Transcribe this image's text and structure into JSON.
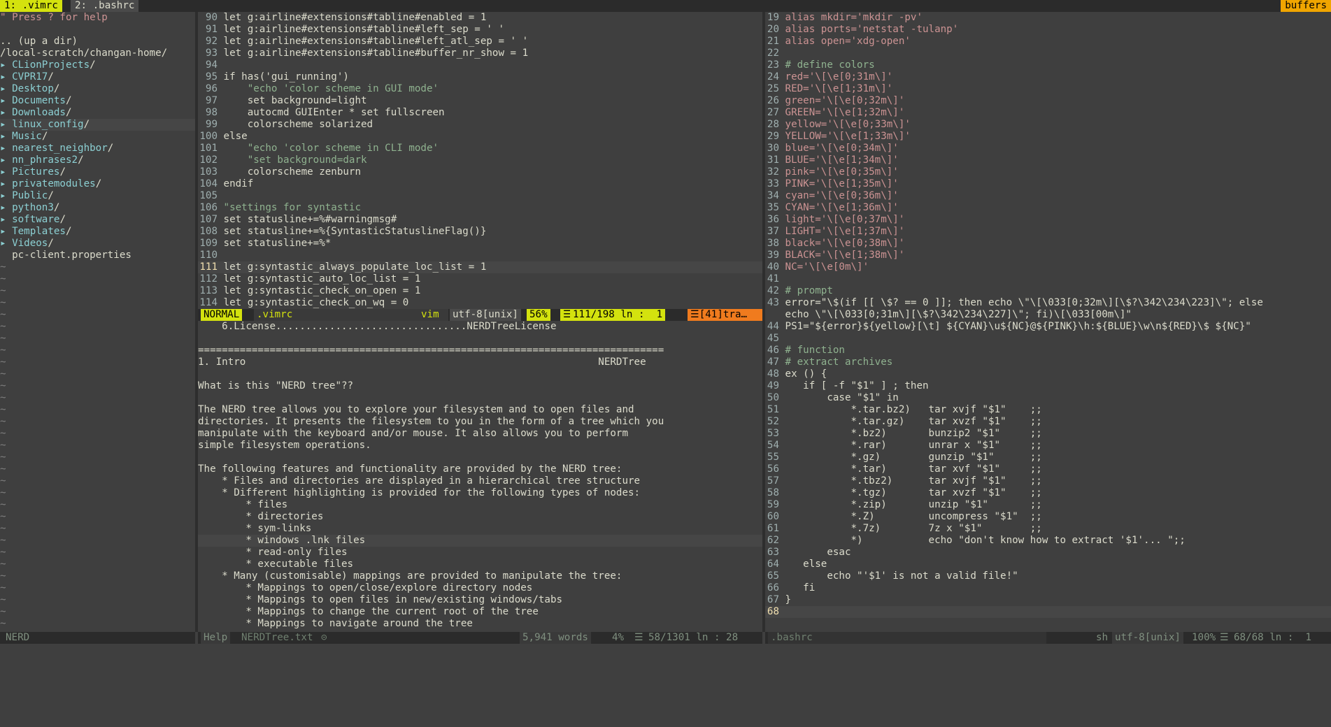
{
  "tabline": {
    "tabs": [
      {
        "label": "1: .vimrc",
        "active": true
      },
      {
        "label": "2: .bashrc",
        "active": false
      }
    ],
    "buffers_label": "buffers"
  },
  "nerdtree": {
    "lines": [
      {
        "text": "\" Press ? for help",
        "kind": "cmt"
      },
      {
        "text": "",
        "kind": "plain"
      },
      {
        "text": ".. (up a dir)",
        "kind": "plain"
      },
      {
        "text": "/local-scratch/changan-home/",
        "kind": "plain"
      },
      {
        "text": "CLionProjects",
        "kind": "dir"
      },
      {
        "text": "CVPR17",
        "kind": "dir"
      },
      {
        "text": "Desktop",
        "kind": "dir"
      },
      {
        "text": "Documents",
        "kind": "dir"
      },
      {
        "text": "Downloads",
        "kind": "dir"
      },
      {
        "text": "linux_config",
        "kind": "dir",
        "current": true
      },
      {
        "text": "Music",
        "kind": "dir"
      },
      {
        "text": "nearest_neighbor",
        "kind": "dir"
      },
      {
        "text": "nn_phrases2",
        "kind": "dir"
      },
      {
        "text": "Pictures",
        "kind": "dir"
      },
      {
        "text": "privatemodules",
        "kind": "dir"
      },
      {
        "text": "Public",
        "kind": "dir"
      },
      {
        "text": "python3",
        "kind": "dir"
      },
      {
        "text": "software",
        "kind": "dir"
      },
      {
        "text": "Templates",
        "kind": "dir"
      },
      {
        "text": "Videos",
        "kind": "dir"
      },
      {
        "text": "  pc-client.properties",
        "kind": "plain"
      }
    ],
    "status": "NERD"
  },
  "vimrc": {
    "lines": [
      {
        "n": "90",
        "t": "let g:airline#extensions#tabline#enabled = 1"
      },
      {
        "n": "91",
        "t": "let g:airline#extensions#tabline#left_sep = ' '"
      },
      {
        "n": "92",
        "t": "let g:airline#extensions#tabline#left_atl_sep = ' '"
      },
      {
        "n": "93",
        "t": "let g:airline#extensions#tabline#buffer_nr_show = 1"
      },
      {
        "n": "94",
        "t": ""
      },
      {
        "n": "95",
        "t": "if has('gui_running')"
      },
      {
        "n": "96",
        "t": "    \"echo 'color scheme in GUI mode'"
      },
      {
        "n": "97",
        "t": "    set background=light"
      },
      {
        "n": "98",
        "t": "    autocmd GUIEnter * set fullscreen"
      },
      {
        "n": "99",
        "t": "    colorscheme solarized"
      },
      {
        "n": "100",
        "t": "else"
      },
      {
        "n": "101",
        "t": "    \"echo 'color scheme in CLI mode'"
      },
      {
        "n": "102",
        "t": "    \"set background=dark"
      },
      {
        "n": "103",
        "t": "    colorscheme zenburn"
      },
      {
        "n": "104",
        "t": "endif"
      },
      {
        "n": "105",
        "t": ""
      },
      {
        "n": "106",
        "t": "\"settings for syntastic"
      },
      {
        "n": "107",
        "t": "set statusline+=%#warningmsg#"
      },
      {
        "n": "108",
        "t": "set statusline+=%{SyntasticStatuslineFlag()}"
      },
      {
        "n": "109",
        "t": "set statusline+=%*"
      },
      {
        "n": "110",
        "t": ""
      },
      {
        "n": "111",
        "t": "let g:syntastic_always_populate_loc_list = 1",
        "current": true
      },
      {
        "n": "112",
        "t": "let g:syntastic_auto_loc_list = 1"
      },
      {
        "n": "113",
        "t": "let g:syntastic_check_on_open = 1"
      },
      {
        "n": "114",
        "t": "let g:syntastic_check_on_wq = 0"
      }
    ],
    "status": {
      "mode": "NORMAL",
      "file": ".vimrc",
      "filetype": "vim",
      "encoding": "utf-8[unix]",
      "percent": "56%",
      "position": "111/198 ln :  1",
      "warning": "☰[41]tra…"
    }
  },
  "help": {
    "lines": [
      "    6.License................................NERDTreeLicense",
      "",
      "==============================================================================",
      "1. Intro                                                           NERDTree",
      "",
      "What is this \"NERD tree\"??",
      "",
      "The NERD tree allows you to explore your filesystem and to open files and",
      "directories. It presents the filesystem to you in the form of a tree which you",
      "manipulate with the keyboard and/or mouse. It also allows you to perform",
      "simple filesystem operations.",
      "",
      "The following features and functionality are provided by the NERD tree:",
      "    * Files and directories are displayed in a hierarchical tree structure",
      "    * Different highlighting is provided for the following types of nodes:",
      "        * files",
      "        * directories",
      "        * sym-links",
      "        * windows .lnk files",
      "        * read-only files",
      "        * executable files",
      "    * Many (customisable) mappings are provided to manipulate the tree:",
      "        * Mappings to open/close/explore directory nodes",
      "        * Mappings to open files in new/existing windows/tabs",
      "        * Mappings to change the current root of the tree",
      "        * Mappings to navigate around the tree"
    ],
    "status": {
      "mode": "Help",
      "file": "NERDTree.txt",
      "words": "5,941 words",
      "percent": "4%",
      "position": "58/1301 ln : 28"
    }
  },
  "bashrc": {
    "lines": [
      {
        "n": "19",
        "t": "alias mkdir='mkdir -pv'"
      },
      {
        "n": "20",
        "t": "alias ports='netstat -tulanp'"
      },
      {
        "n": "21",
        "t": "alias open='xdg-open'"
      },
      {
        "n": "22",
        "t": ""
      },
      {
        "n": "23",
        "t": "# define colors"
      },
      {
        "n": "24",
        "t": "red='\\[\\e[0;31m\\]'"
      },
      {
        "n": "25",
        "t": "RED='\\[\\e[1;31m\\]'"
      },
      {
        "n": "26",
        "t": "green='\\[\\e[0;32m\\]'"
      },
      {
        "n": "27",
        "t": "GREEN='\\[\\e[1;32m\\]'"
      },
      {
        "n": "28",
        "t": "yellow='\\[\\e[0;33m\\]'"
      },
      {
        "n": "29",
        "t": "YELLOW='\\[\\e[1;33m\\]'"
      },
      {
        "n": "30",
        "t": "blue='\\[\\e[0;34m\\]'"
      },
      {
        "n": "31",
        "t": "BLUE='\\[\\e[1;34m\\]'"
      },
      {
        "n": "32",
        "t": "pink='\\[\\e[0;35m\\]'"
      },
      {
        "n": "33",
        "t": "PINK='\\[\\e[1;35m\\]'"
      },
      {
        "n": "34",
        "t": "cyan='\\[\\e[0;36m\\]'"
      },
      {
        "n": "35",
        "t": "CYAN='\\[\\e[1;36m\\]'"
      },
      {
        "n": "36",
        "t": "light='\\[\\e[0;37m\\]'"
      },
      {
        "n": "37",
        "t": "LIGHT='\\[\\e[1;37m\\]'"
      },
      {
        "n": "38",
        "t": "black='\\[\\e[0;38m\\]'"
      },
      {
        "n": "39",
        "t": "BLACK='\\[\\e[1;38m\\]'"
      },
      {
        "n": "40",
        "t": "NC='\\[\\e[0m\\]'"
      },
      {
        "n": "41",
        "t": ""
      },
      {
        "n": "42",
        "t": "# prompt"
      },
      {
        "n": "43",
        "t": "error=\"\\$(if [[ \\$? == 0 ]]; then echo \\\"\\[\\033[0;32m\\][\\$?\\342\\234\\223]\\\"; else"
      },
      {
        "n": "",
        "t": "echo \\\"\\[\\033[0;31m\\][\\$?\\342\\234\\227]\\\"; fi)\\[\\033[00m\\]\""
      },
      {
        "n": "44",
        "t": "PS1=\"${error}${yellow}[\\t] ${CYAN}\\u${NC}@${PINK}\\h:${BLUE}\\w\\n${RED}\\$ ${NC}\""
      },
      {
        "n": "45",
        "t": ""
      },
      {
        "n": "46",
        "t": "# function"
      },
      {
        "n": "47",
        "t": "# extract archives"
      },
      {
        "n": "48",
        "t": "ex () {"
      },
      {
        "n": "49",
        "t": "   if [ -f \"$1\" ] ; then"
      },
      {
        "n": "50",
        "t": "       case \"$1\" in"
      },
      {
        "n": "51",
        "t": "           *.tar.bz2)   tar xvjf \"$1\"    ;;"
      },
      {
        "n": "52",
        "t": "           *.tar.gz)    tar xvzf \"$1\"    ;;"
      },
      {
        "n": "53",
        "t": "           *.bz2)       bunzip2 \"$1\"     ;;"
      },
      {
        "n": "54",
        "t": "           *.rar)       unrar x \"$1\"     ;;"
      },
      {
        "n": "55",
        "t": "           *.gz)        gunzip \"$1\"      ;;"
      },
      {
        "n": "56",
        "t": "           *.tar)       tar xvf \"$1\"     ;;"
      },
      {
        "n": "57",
        "t": "           *.tbz2)      tar xvjf \"$1\"    ;;"
      },
      {
        "n": "58",
        "t": "           *.tgz)       tar xvzf \"$1\"    ;;"
      },
      {
        "n": "59",
        "t": "           *.zip)       unzip \"$1\"       ;;"
      },
      {
        "n": "60",
        "t": "           *.Z)         uncompress \"$1\"  ;;"
      },
      {
        "n": "61",
        "t": "           *.7z)        7z x \"$1\"        ;;"
      },
      {
        "n": "62",
        "t": "           *)           echo \"don't know how to extract '$1'... \";;"
      },
      {
        "n": "63",
        "t": "       esac"
      },
      {
        "n": "64",
        "t": "   else"
      },
      {
        "n": "65",
        "t": "       echo \"'$1' is not a valid file!\""
      },
      {
        "n": "66",
        "t": "   fi"
      },
      {
        "n": "67",
        "t": "}"
      },
      {
        "n": "68",
        "t": "",
        "current": true
      }
    ],
    "status": {
      "file": ".bashrc",
      "filetype": "sh",
      "encoding": "utf-8[unix]",
      "percent": "100%",
      "position": "68/68 ln :  1"
    }
  },
  "colors": {
    "background": "#3f3f3f",
    "normal_mode": "#d4e20e",
    "buffers_tab": "#f0a500",
    "warning": "#f07b1e"
  }
}
